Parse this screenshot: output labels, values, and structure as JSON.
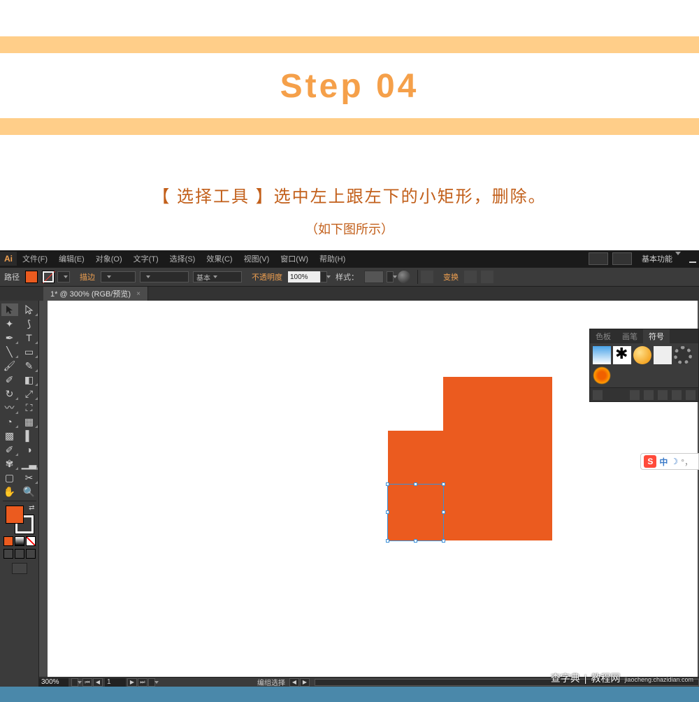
{
  "header": {
    "step_title": "Step 04"
  },
  "instruction": {
    "main": "【 选择工具 】选中左上跟左下的小矩形，删除。",
    "sub": "（如下图所示）"
  },
  "ai": {
    "logo": "Ai",
    "menu": {
      "file": "文件(F)",
      "edit": "编辑(E)",
      "object": "对象(O)",
      "type": "文字(T)",
      "select": "选择(S)",
      "effect": "效果(C)",
      "view": "视图(V)",
      "window": "窗口(W)",
      "help": "帮助(H)"
    },
    "workspace": "基本功能",
    "options": {
      "path_label": "路径",
      "stroke_label": "描边",
      "stroke_pt": "",
      "brush_basic": "基本",
      "opacity_label": "不透明度",
      "opacity_value": "100%",
      "style_label": "样式：",
      "transform_label": "变换"
    },
    "doc_tab": "1* @ 300% (RGB/预览)",
    "panel": {
      "tab_swatches": "色板",
      "tab_brushes": "画笔",
      "tab_symbols": "符号"
    },
    "status": {
      "zoom": "300%",
      "page": "1",
      "mode": "编组选择"
    }
  },
  "ime": {
    "logo": "S",
    "cn": "中",
    "moon": "☽",
    "punct": "°，"
  },
  "watermark": {
    "brand": "查字典",
    "divider": "|",
    "site": "教程网",
    "url": "jiaocheng.chazidian.com"
  },
  "colors": {
    "accent_orange": "#eb5b1f",
    "band": "#ffce89",
    "step_title": "#f5a04a",
    "instruction": "#c25f1a"
  }
}
